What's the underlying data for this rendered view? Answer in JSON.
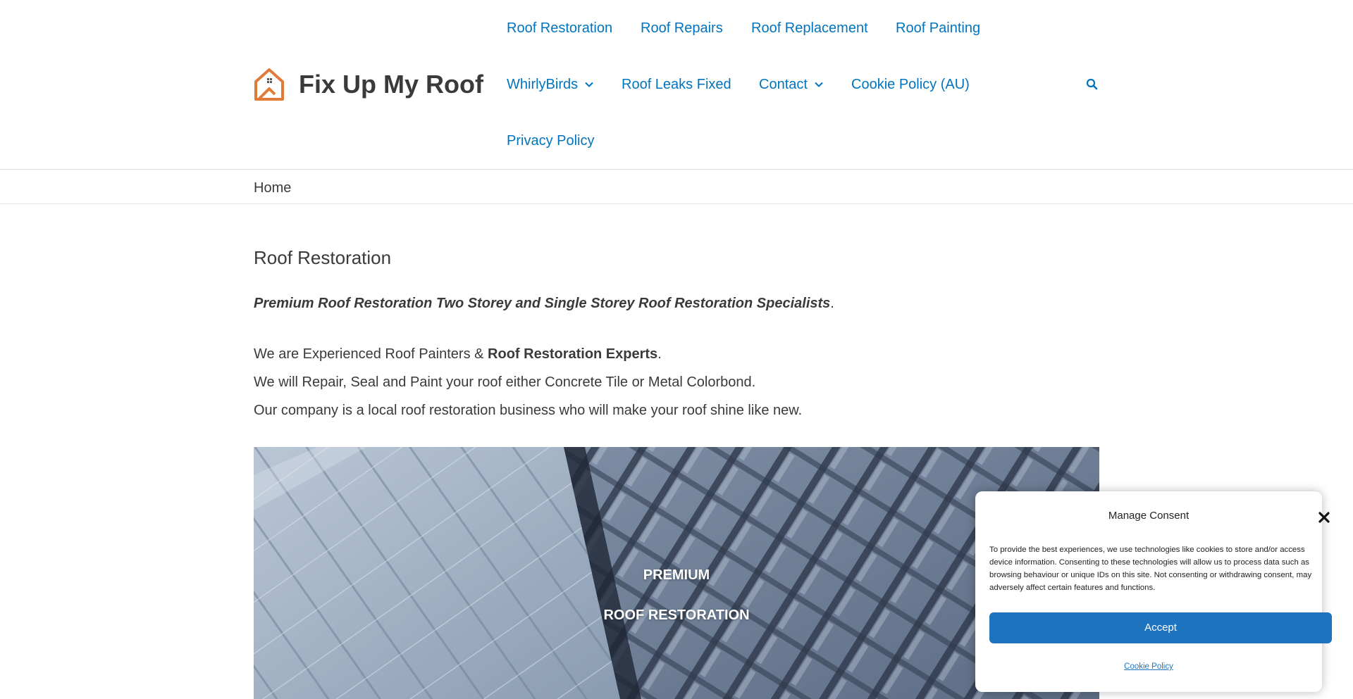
{
  "site": {
    "title": "Fix Up My Roof",
    "logo": "house-logo-icon",
    "brand_color": "#e07b39",
    "link_color": "#0274be"
  },
  "nav": {
    "row1": [
      "Roof Restoration",
      "Roof Repairs",
      "Roof Replacement",
      "Roof Painting"
    ],
    "row2": [
      "WhirlyBirds",
      "Roof Leaks Fixed",
      "Contact",
      "Cookie Policy (AU)"
    ],
    "row3": [
      "Privacy Policy"
    ],
    "search_icon": "search-icon"
  },
  "breadcrumb": "Home",
  "content": {
    "page_title": "Roof Restoration",
    "intro_emphasis": "Premium Roof Restoration Two Storey and Single Storey Roof Restoration Specialists",
    "intro_end": ".",
    "para1_pre": "We are Experienced Roof Painters & ",
    "para1_strong": "Roof Restoration Experts",
    "para1_end": ".",
    "para2": "We will Repair, Seal and Paint your roof either Concrete Tile or Metal Colorbond.",
    "para3": "Our company is a local roof restoration business who will make your roof shine like new."
  },
  "hero": {
    "line1": "PREMIUM",
    "line2": "ROOF RESTORATION"
  },
  "consent": {
    "title": "Manage Consent",
    "body": "To provide the best experiences, we use technologies like cookies to store and/or access device information. Consenting to these technologies will allow us to process data such as browsing behaviour or unique IDs on this site. Not consenting or withdrawing consent, may adversely affect certain features and functions.",
    "accept_label": "Accept",
    "policy_link": "Cookie Policy",
    "accent_color": "#1e73be"
  }
}
